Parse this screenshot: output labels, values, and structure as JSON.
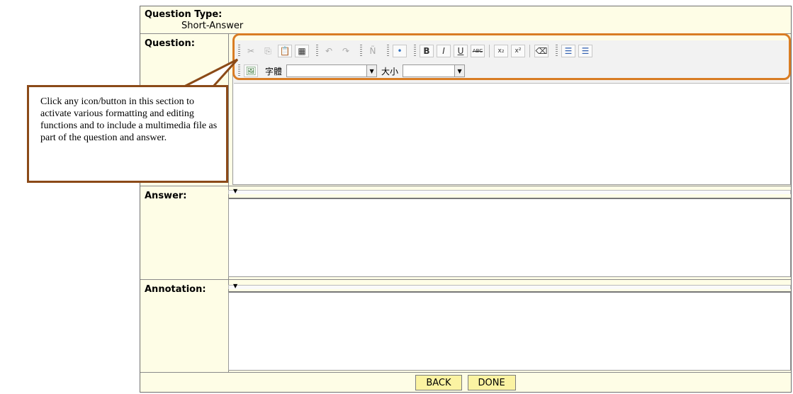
{
  "form": {
    "question_type_label": "Question Type:",
    "question_type_value": "Short-Answer",
    "question_label": "Question:",
    "answer_label": "Answer:",
    "annotation_label": "Annotation:"
  },
  "toolbar": {
    "row1": [
      {
        "name": "cut-icon",
        "glyph": "✂",
        "dim": true
      },
      {
        "name": "copy-icon",
        "glyph": "⎘",
        "dim": true
      },
      {
        "name": "paste-icon",
        "glyph": "📋",
        "dim": false
      },
      {
        "name": "select-all-icon",
        "glyph": "▦",
        "dim": false
      },
      {
        "name": "undo-icon",
        "glyph": "↶",
        "dim": true
      },
      {
        "name": "redo-icon",
        "glyph": "↷",
        "dim": true
      },
      {
        "name": "special-char-icon",
        "glyph": "Ñ",
        "dim": true
      },
      {
        "name": "insert-icon",
        "glyph": "•",
        "dim": false
      },
      {
        "name": "bold-icon",
        "glyph": "B",
        "dim": false
      },
      {
        "name": "italic-icon",
        "glyph": "I",
        "dim": false
      },
      {
        "name": "underline-icon",
        "glyph": "U",
        "dim": false
      },
      {
        "name": "strikethrough-icon",
        "glyph": "ABC",
        "dim": false
      },
      {
        "name": "subscript-icon",
        "glyph": "x₂",
        "dim": false
      },
      {
        "name": "superscript-icon",
        "glyph": "x²",
        "dim": false
      },
      {
        "name": "eraser-icon",
        "glyph": "⌫",
        "dim": false
      },
      {
        "name": "ordered-list-icon",
        "glyph": "☰",
        "dim": false
      },
      {
        "name": "unordered-list-icon",
        "glyph": "☰",
        "dim": false
      }
    ],
    "font_label": "字體",
    "size_label": "大小"
  },
  "callout": {
    "text": "Click any icon/button in this section to activate various formatting and editing functions and to include a multimedia file as part of the question and answer."
  },
  "buttons": {
    "back": "BACK",
    "done": "DONE"
  },
  "colors": {
    "form_background": "#fefde6",
    "button_background": "#fbf3a2",
    "highlight_border": "#d97d24",
    "callout_border": "#8b4a18"
  }
}
